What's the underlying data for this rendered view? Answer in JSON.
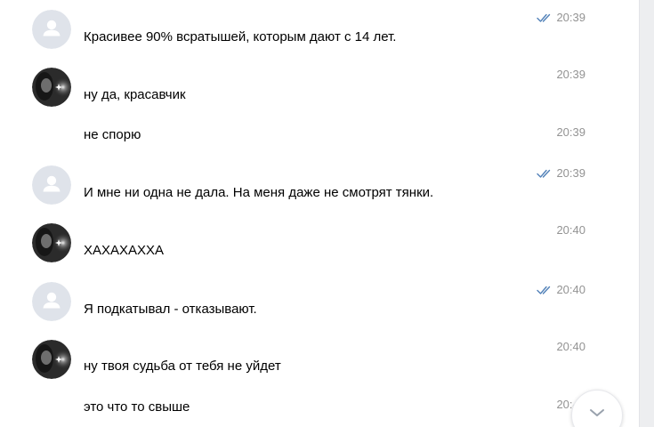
{
  "messages": [
    {
      "sender": "self",
      "text": "Красивее 90% всратышей, которым дают с 14 лет.",
      "time": "20:39",
      "read_icon": "double-check-icon"
    },
    {
      "sender": "other",
      "text": "ну да, красавчик",
      "time": "20:39"
    },
    {
      "sender": "other",
      "text": "не спорю",
      "time": "20:39"
    },
    {
      "sender": "self",
      "text": "И мне ни одна не дала. На меня даже не смотрят тянки.",
      "time": "20:39",
      "read_icon": "double-check-icon"
    },
    {
      "sender": "other",
      "text": "ХАХАХАХХА",
      "time": "20:40"
    },
    {
      "sender": "self",
      "text": "Я подкатывал - отказывают.",
      "time": "20:40",
      "read_icon": "double-check-icon"
    },
    {
      "sender": "other",
      "text": "ну твоя судьба от тебя не уйдет",
      "time": "20:40"
    },
    {
      "sender": "other",
      "text": "это что то свыше",
      "time": "20:40"
    }
  ],
  "icons": {
    "read": "double-check-icon",
    "scroll_down": "chevron-down-icon",
    "self_avatar": "default-user-avatar",
    "other_avatar": "photo-avatar"
  },
  "colors": {
    "text": "#000000",
    "time": "#939393",
    "read_check": "#5181b8",
    "self_avatar_bg": "#dfe3ea",
    "self_avatar_fg": "#ffffff",
    "scroll_chevron": "#99a2ad"
  }
}
